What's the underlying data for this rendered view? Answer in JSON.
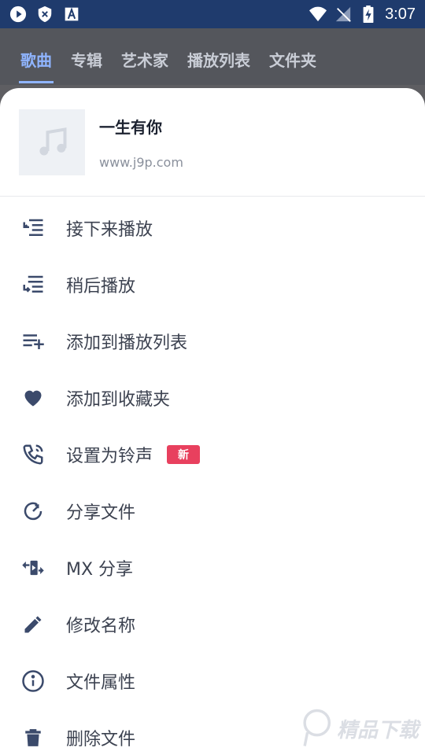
{
  "status": {
    "time": "3:07",
    "icons_left": [
      "play-icon",
      "shield-x-icon",
      "font-a-icon"
    ],
    "icons_right": [
      "wifi-icon",
      "no-signal-icon",
      "battery-charging-icon"
    ]
  },
  "tabs": [
    {
      "label": "歌曲",
      "active": true
    },
    {
      "label": "专辑",
      "active": false
    },
    {
      "label": "艺术家",
      "active": false
    },
    {
      "label": "播放列表",
      "active": false
    },
    {
      "label": "文件夹",
      "active": false
    }
  ],
  "song": {
    "title": "一生有你",
    "subtitle": "www.j9p.com"
  },
  "menu": [
    {
      "label": "接下来播放",
      "icon": "play-next-icon"
    },
    {
      "label": "稍后播放",
      "icon": "play-later-icon"
    },
    {
      "label": "添加到播放列表",
      "icon": "playlist-add-icon"
    },
    {
      "label": "添加到收藏夹",
      "icon": "heart-icon"
    },
    {
      "label": "设置为铃声",
      "icon": "ringtone-phone-icon",
      "badge": "新"
    },
    {
      "label": "分享文件",
      "icon": "share-circle-icon"
    },
    {
      "label": "MX 分享",
      "icon": "mx-share-icon"
    },
    {
      "label": "修改名称",
      "icon": "pencil-icon"
    },
    {
      "label": "文件属性",
      "icon": "info-icon"
    },
    {
      "label": "删除文件",
      "icon": "trash-icon"
    }
  ],
  "colors": {
    "statusbar": "#1f3b6d",
    "accent": "#8fb4ff",
    "icon": "#3b4a6b",
    "badge": "#e8405e"
  }
}
